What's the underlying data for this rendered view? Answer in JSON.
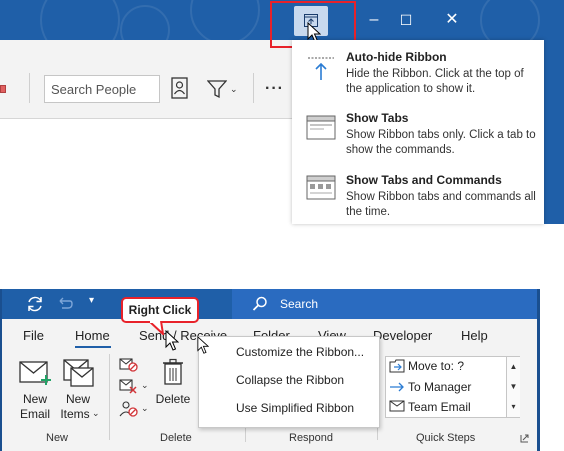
{
  "panel1": {
    "search_placeholder": "Search People",
    "window_buttons": {
      "minimize": "–",
      "maximize": "☐",
      "close": "✕"
    },
    "menu": [
      {
        "title": "Auto-hide Ribbon",
        "description": "Hide the Ribbon. Click at the top of the application to show it."
      },
      {
        "title": "Show Tabs",
        "description": "Show Ribbon tabs only. Click a tab to show the commands."
      },
      {
        "title": "Show Tabs and Commands",
        "description": "Show Ribbon tabs and commands all the time."
      }
    ],
    "colors": {
      "titlebar": "#1f5fa8",
      "highlight": "#e8222a"
    }
  },
  "panel2": {
    "search_label": "Search",
    "callout": "Right Click",
    "tabs": [
      "File",
      "Home",
      "Send / Receive",
      "Folder",
      "View",
      "Developer",
      "Help"
    ],
    "new_group": {
      "new_email": [
        "New",
        "Email"
      ],
      "new_items": [
        "New",
        "Items"
      ],
      "label": "New"
    },
    "delete_group": {
      "delete_label": "Delete",
      "label": "Delete"
    },
    "respond_group": {
      "label": "Respond"
    },
    "quick_steps": {
      "items": [
        "Move to: ?",
        "To Manager",
        "Team Email"
      ],
      "label": "Quick Steps"
    },
    "context_menu": [
      "Customize the Ribbon...",
      "Collapse the Ribbon",
      "Use Simplified Ribbon"
    ]
  }
}
